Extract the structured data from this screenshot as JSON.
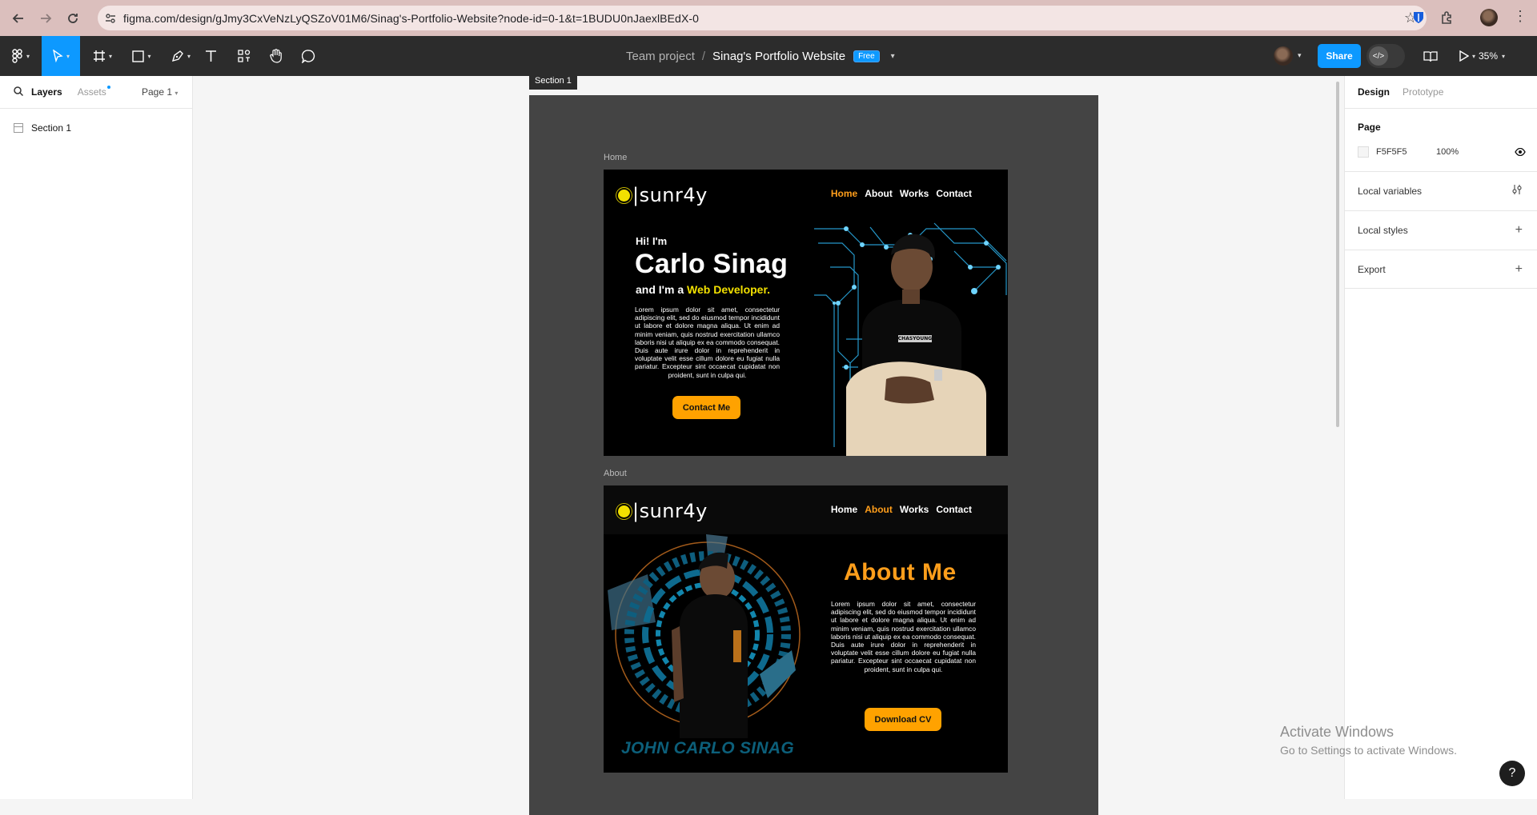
{
  "browser": {
    "url": "figma.com/design/gJmy3CxVeNzLyQSZoV01M6/Sinag's-Portfolio-Website?node-id=0-1&t=1BUDU0nJaexlBEdX-0"
  },
  "toolbar": {
    "team": "Team project",
    "separator": "/",
    "file_name": "Sinag's Portfolio Website",
    "plan_badge": "Free",
    "share_label": "Share",
    "zoom": "35%"
  },
  "left_panel": {
    "tab_layers": "Layers",
    "tab_assets": "Assets",
    "page_selector": "Page 1",
    "layers": [
      {
        "name": "Section 1"
      }
    ]
  },
  "canvas": {
    "section_label": "Section 1",
    "home_label": "Home",
    "about_label": "About",
    "home": {
      "logo": "|sunr4y",
      "nav": [
        "Home",
        "About",
        "Works",
        "Contact"
      ],
      "active_nav": "Home",
      "greeting": "Hi! I'm",
      "name": "Carlo Sinag",
      "role_prefix": "and I'm a ",
      "role_highlight": "Web Developer.",
      "body": "Lorem ipsum dolor sit amet, consectetur adipiscing elit, sed do eiusmod tempor incididunt ut labore et dolore magna aliqua. Ut enim ad minim veniam, quis nostrud exercitation ullamco laboris nisi ut aliquip ex ea commodo consequat. Duis aute irure dolor in reprehenderit in voluptate velit esse cillum dolore eu fugiat nulla pariatur. Excepteur sint occaecat cupidatat non proident, sunt in culpa qui.",
      "cta": "Contact Me",
      "shirt_text": "CHASYOUNG"
    },
    "about": {
      "logo": "|sunr4y",
      "nav": [
        "Home",
        "About",
        "Works",
        "Contact"
      ],
      "active_nav": "About",
      "title": "About Me",
      "body": "Lorem ipsum dolor sit amet, consectetur adipiscing elit, sed do eiusmod tempor incididunt ut labore et dolore magna aliqua. Ut enim ad minim veniam, quis nostrud exercitation ullamco laboris nisi ut aliquip ex ea commodo consequat. Duis aute irure dolor in reprehenderit in voluptate velit esse cillum dolore eu fugiat nulla pariatur. Excepteur sint occaecat cupidatat non proident, sunt in culpa qui.",
      "cta": "Download CV",
      "banner_name": "JOHN CARLO SINAG"
    }
  },
  "right_panel": {
    "tab_design": "Design",
    "tab_prototype": "Prototype",
    "page_title": "Page",
    "page_color": "F5F5F5",
    "page_opacity": "100%",
    "local_variables": "Local variables",
    "local_styles": "Local styles",
    "export": "Export"
  },
  "watermark": {
    "title": "Activate Windows",
    "subtitle": "Go to Settings to activate Windows."
  },
  "help_label": "?",
  "colors": {
    "figma_blue": "#0d99ff",
    "accent_orange": "#ffa200",
    "accent_yellow": "#f2e000",
    "toolbar_bg": "#2c2c2c"
  },
  "icons": [
    "back-arrow-icon",
    "forward-arrow-icon",
    "reload-icon",
    "site-info-icon",
    "star-icon",
    "bitwarden-icon",
    "extensions-icon",
    "figma-menu-icon",
    "move-tool-icon",
    "frame-tool-icon",
    "shape-tool-icon",
    "pen-tool-icon",
    "text-tool-icon",
    "resources-icon",
    "hand-tool-icon",
    "comment-icon",
    "dev-mode-icon",
    "library-icon",
    "present-icon",
    "search-icon",
    "eye-icon",
    "variables-icon",
    "plus-icon"
  ]
}
